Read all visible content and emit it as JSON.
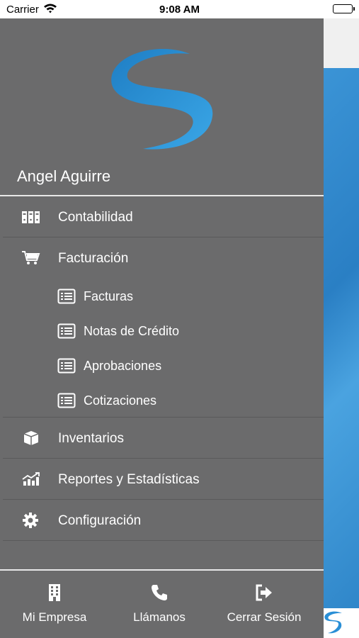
{
  "status_bar": {
    "carrier": "Carrier",
    "time": "9:08 AM"
  },
  "drawer": {
    "user_name": "Angel Aguirre",
    "menu": [
      {
        "label": "Contabilidad",
        "icon": "archive-binders-icon"
      },
      {
        "label": "Facturación",
        "icon": "shopping-cart-icon"
      },
      {
        "label": "Inventarios",
        "icon": "box-icon"
      },
      {
        "label": "Reportes y Estadísticas",
        "icon": "chart-icon"
      },
      {
        "label": "Configuración",
        "icon": "gear-icon"
      }
    ],
    "submenu": [
      {
        "label": "Facturas",
        "icon": "list-icon"
      },
      {
        "label": "Notas de Crédito",
        "icon": "list-icon"
      },
      {
        "label": "Aprobaciones",
        "icon": "list-icon"
      },
      {
        "label": "Cotizaciones",
        "icon": "list-icon"
      }
    ]
  },
  "bottom_bar": {
    "mi_empresa": "Mi Empresa",
    "llamanos": "Llámanos",
    "cerrar_sesion": "Cerrar Sesión"
  },
  "colors": {
    "drawer_bg": "#6b6b6c",
    "brand_blue": "#2a8fd6"
  }
}
